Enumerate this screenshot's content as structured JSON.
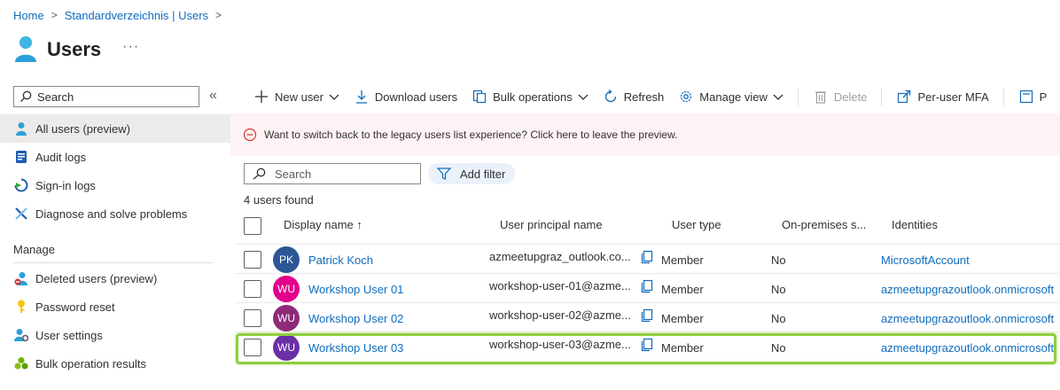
{
  "breadcrumb": {
    "home": "Home",
    "directory": "Standardverzeichnis | Users",
    "sep": ">"
  },
  "title": {
    "text": "Users",
    "more": "···"
  },
  "sidebar": {
    "search_placeholder": "Search",
    "collapse": "«",
    "items": [
      {
        "label": "All users (preview)",
        "icon": "user-icon"
      },
      {
        "label": "Audit logs",
        "icon": "audit-logs-icon"
      },
      {
        "label": "Sign-in logs",
        "icon": "sign-in-logs-icon"
      },
      {
        "label": "Diagnose and solve problems",
        "icon": "wrench-icon"
      }
    ],
    "manage_heading": "Manage",
    "manage_items": [
      {
        "label": "Deleted users (preview)",
        "icon": "deleted-user-icon"
      },
      {
        "label": "Password reset",
        "icon": "key-icon"
      },
      {
        "label": "User settings",
        "icon": "user-settings-icon"
      },
      {
        "label": "Bulk operation results",
        "icon": "bulk-results-icon"
      }
    ]
  },
  "toolbar": {
    "new_user": "New user",
    "download_users": "Download users",
    "bulk_operations": "Bulk operations",
    "refresh": "Refresh",
    "manage_view": "Manage view",
    "delete": "Delete",
    "per_user_mfa": "Per-user MFA",
    "cut_item": "P"
  },
  "banner": {
    "text": "Want to switch back to the legacy users list experience? Click here to leave the preview."
  },
  "list": {
    "search_placeholder": "Search",
    "add_filter": "Add filter",
    "count_text": "4 users found"
  },
  "table": {
    "columns": {
      "display_name": "Display name ↑",
      "upn": "User principal name",
      "user_type": "User type",
      "on_prem": "On-premises s...",
      "identities": "Identities"
    },
    "rows": [
      {
        "initials": "PK",
        "avatar_color": "#2b5797",
        "name": "Patrick Koch",
        "upn": "azmeetupgraz_outlook.co...",
        "type": "Member",
        "onprem": "No",
        "identity": "MicrosoftAccount"
      },
      {
        "initials": "WU",
        "avatar_color": "#e3008c",
        "name": "Workshop User 01",
        "upn": "workshop-user-01@azme...",
        "type": "Member",
        "onprem": "No",
        "identity": "azmeetupgrazoutlook.onmicrosoft"
      },
      {
        "initials": "WU",
        "avatar_color": "#8e2a7a",
        "name": "Workshop User 02",
        "upn": "workshop-user-02@azme...",
        "type": "Member",
        "onprem": "No",
        "identity": "azmeetupgrazoutlook.onmicrosoft"
      },
      {
        "initials": "WU",
        "avatar_color": "#6b2fa8",
        "name": "Workshop User 03",
        "upn": "workshop-user-03@azme...",
        "type": "Member",
        "onprem": "No",
        "identity": "azmeetupgrazoutlook.onmicrosoft"
      }
    ]
  },
  "colors": {
    "link": "#0f6cbd",
    "banner_bg": "#fdf3f4",
    "highlight": "#8fce3f"
  }
}
